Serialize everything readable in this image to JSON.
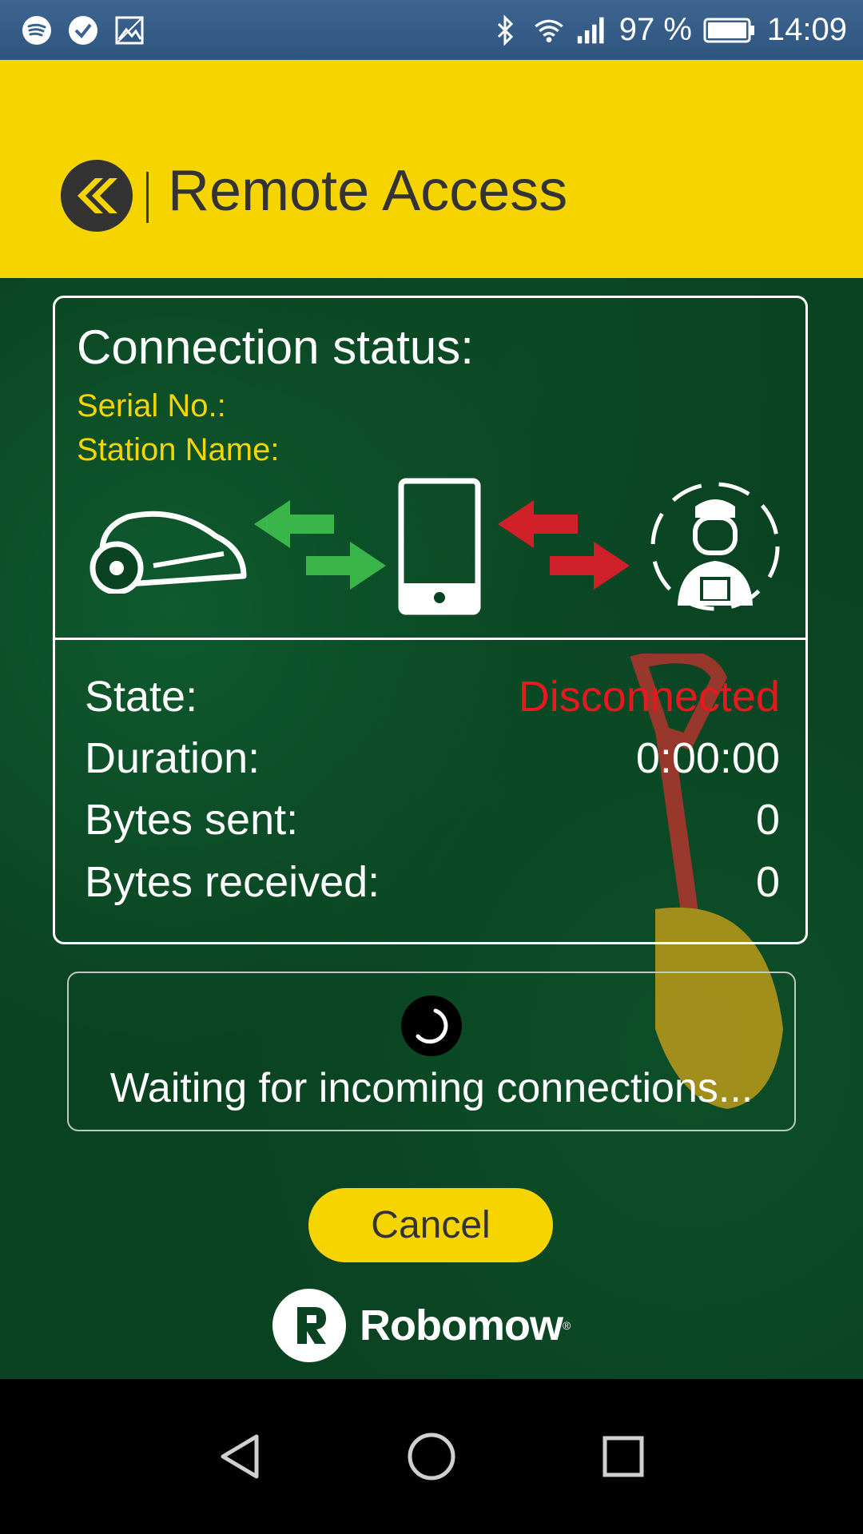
{
  "status_bar": {
    "battery_percent": "97 %",
    "time": "14:09",
    "left_icons": [
      "spotify-icon",
      "check-circle-icon",
      "image-icon"
    ],
    "right_icons": [
      "bluetooth-icon",
      "wifi-icon",
      "signal-icon",
      "battery-icon"
    ]
  },
  "header": {
    "title": "Remote Access"
  },
  "connection": {
    "title": "Connection status:",
    "serial_label": "Serial No.:",
    "station_label": "Station Name:",
    "icons": [
      "mower-icon",
      "arrows-green-icon",
      "phone-icon",
      "arrows-red-icon",
      "technician-icon"
    ],
    "colors": {
      "ok": "#3ab54a",
      "error": "#d0202a"
    }
  },
  "stats": {
    "state_label": "State:",
    "state_value": "Disconnected",
    "duration_label": "Duration:",
    "duration_value": "0:00:00",
    "sent_label": "Bytes sent:",
    "sent_value": "0",
    "received_label": "Bytes received:",
    "received_value": "0"
  },
  "waiting": {
    "text": "Waiting for incoming connections..."
  },
  "cancel_label": "Cancel",
  "brand": {
    "name": "Robomow"
  },
  "theme": {
    "accent": "#f5d400",
    "background": "#0a4322",
    "error": "#e5191e"
  }
}
